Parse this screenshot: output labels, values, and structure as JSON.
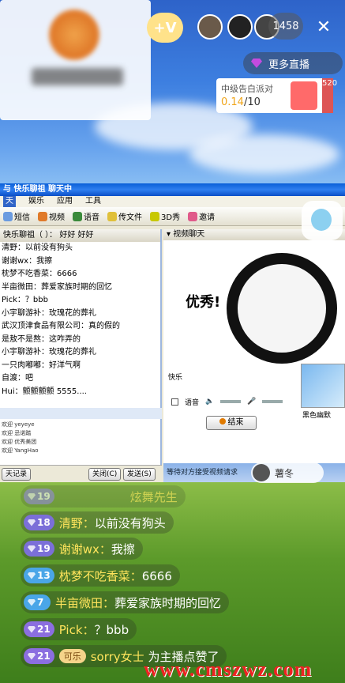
{
  "header": {
    "viewer_count": "1458",
    "close_label": "✕",
    "follow_label": "+V",
    "more_live_label": "更多直播",
    "event": {
      "title": "中级告白派对",
      "progress_current": "0.14",
      "progress_total": "/10",
      "side_text": "520"
    }
  },
  "desktop": {
    "window_title": "与 快乐聊祖 聊天中",
    "menu": [
      "天",
      "娱乐",
      "应用",
      "工具"
    ],
    "toolbar": [
      "短信",
      "视频",
      "语音",
      "传文件",
      "3D秀",
      "邀请"
    ],
    "chat_header": "快乐聊祖（              ）：  好好   好好",
    "chat_lines": [
      "清野：以前没有狗头",
      "谢谢wx：我擦",
      "枕梦不吃香菜：6666",
      "半亩微田：葬爱家族时期的回忆",
      "Pick：？bbb",
      "小宇聊游补：玫瑰花的葬礼",
      "武汉顶津食品有限公司：真的假的",
      "是敖不是熬：这咋弄的",
      "小宇聊游补：玫瑰花的葬礼",
      "一只肉嘟嘟：好洋气啊",
      "自渡：吧",
      "Hui：颤颤颤颤 5555...."
    ],
    "join_lines": [
      "欢迎 yeyeye",
      "欢迎 忌诺踏",
      "欢迎 优秀美团",
      "欢迎 YangHao"
    ],
    "close_btn": "关闭(C)",
    "send_btn": "发送(S)",
    "history_btn": "天记录",
    "video_header": "视频聊天",
    "meme_text": "优秀!",
    "voice_label": "语音",
    "end_btn": "结束",
    "wait_text": "等待对方接受视频请求",
    "thumb_label": "黑色幽默",
    "video_label": "快乐",
    "host_mini_name": "薯冬"
  },
  "comments": [
    {
      "level": "19",
      "name": "炫舞先生",
      "text": "",
      "level_color": "#8a7bd6"
    },
    {
      "level": "18",
      "name": "清野：",
      "text": "以前没有狗头",
      "level_color": "#7b6fd8"
    },
    {
      "level": "19",
      "name": "谢谢wx：",
      "text": "我擦",
      "level_color": "#7b6fd8"
    },
    {
      "level": "13",
      "name": "枕梦不吃香菜：",
      "text": "6666",
      "level_color": "#4aa6e8"
    },
    {
      "level": "7",
      "name": "半亩微田：",
      "text": "葬爱家族时期的回忆",
      "level_color": "#4aa6e8"
    },
    {
      "level": "21",
      "name": "Pick：",
      "text": "？bbb",
      "level_color": "#8b6ee0"
    },
    {
      "level": "21",
      "name": "sorry女士",
      "text": "为主播点赞了",
      "level_color": "#8b6ee0",
      "badge": "可乐"
    }
  ],
  "watermark": "www.cmszwz.com",
  "colors": {
    "accent_yellow": "#ffe45c",
    "watermark_red": "#e22222"
  }
}
